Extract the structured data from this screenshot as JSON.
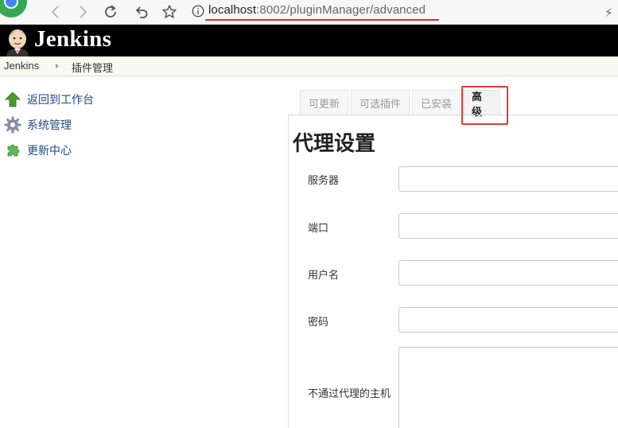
{
  "browser": {
    "url_host": "localhost",
    "url_path": ":8002/pluginManager/advanced",
    "icons": [
      "back-icon",
      "forward-icon",
      "reload-icon",
      "undo-icon",
      "star-icon",
      "info-icon"
    ]
  },
  "header": {
    "title": "Jenkins"
  },
  "breadcrumb": {
    "items": [
      "Jenkins",
      "插件管理"
    ]
  },
  "sidebar": {
    "items": [
      {
        "label": "返回到工作台",
        "icon": "up-arrow-icon"
      },
      {
        "label": "系统管理",
        "icon": "gear-icon"
      },
      {
        "label": "更新中心",
        "icon": "puzzle-icon"
      }
    ]
  },
  "tabs": [
    {
      "label": "可更新",
      "active": false
    },
    {
      "label": "可选插件",
      "active": false
    },
    {
      "label": "已安装",
      "active": false
    },
    {
      "label": "高级",
      "active": true
    }
  ],
  "proxy": {
    "title": "代理设置",
    "fields": [
      {
        "label": "服务器",
        "value": ""
      },
      {
        "label": "端口",
        "value": ""
      },
      {
        "label": "用户名",
        "value": ""
      },
      {
        "label": "密码",
        "value": ""
      },
      {
        "label": "不通过代理的主机",
        "value": ""
      }
    ]
  },
  "colors": {
    "header_bg": "#000000",
    "link": "#204a87",
    "highlight": "#e53935"
  }
}
